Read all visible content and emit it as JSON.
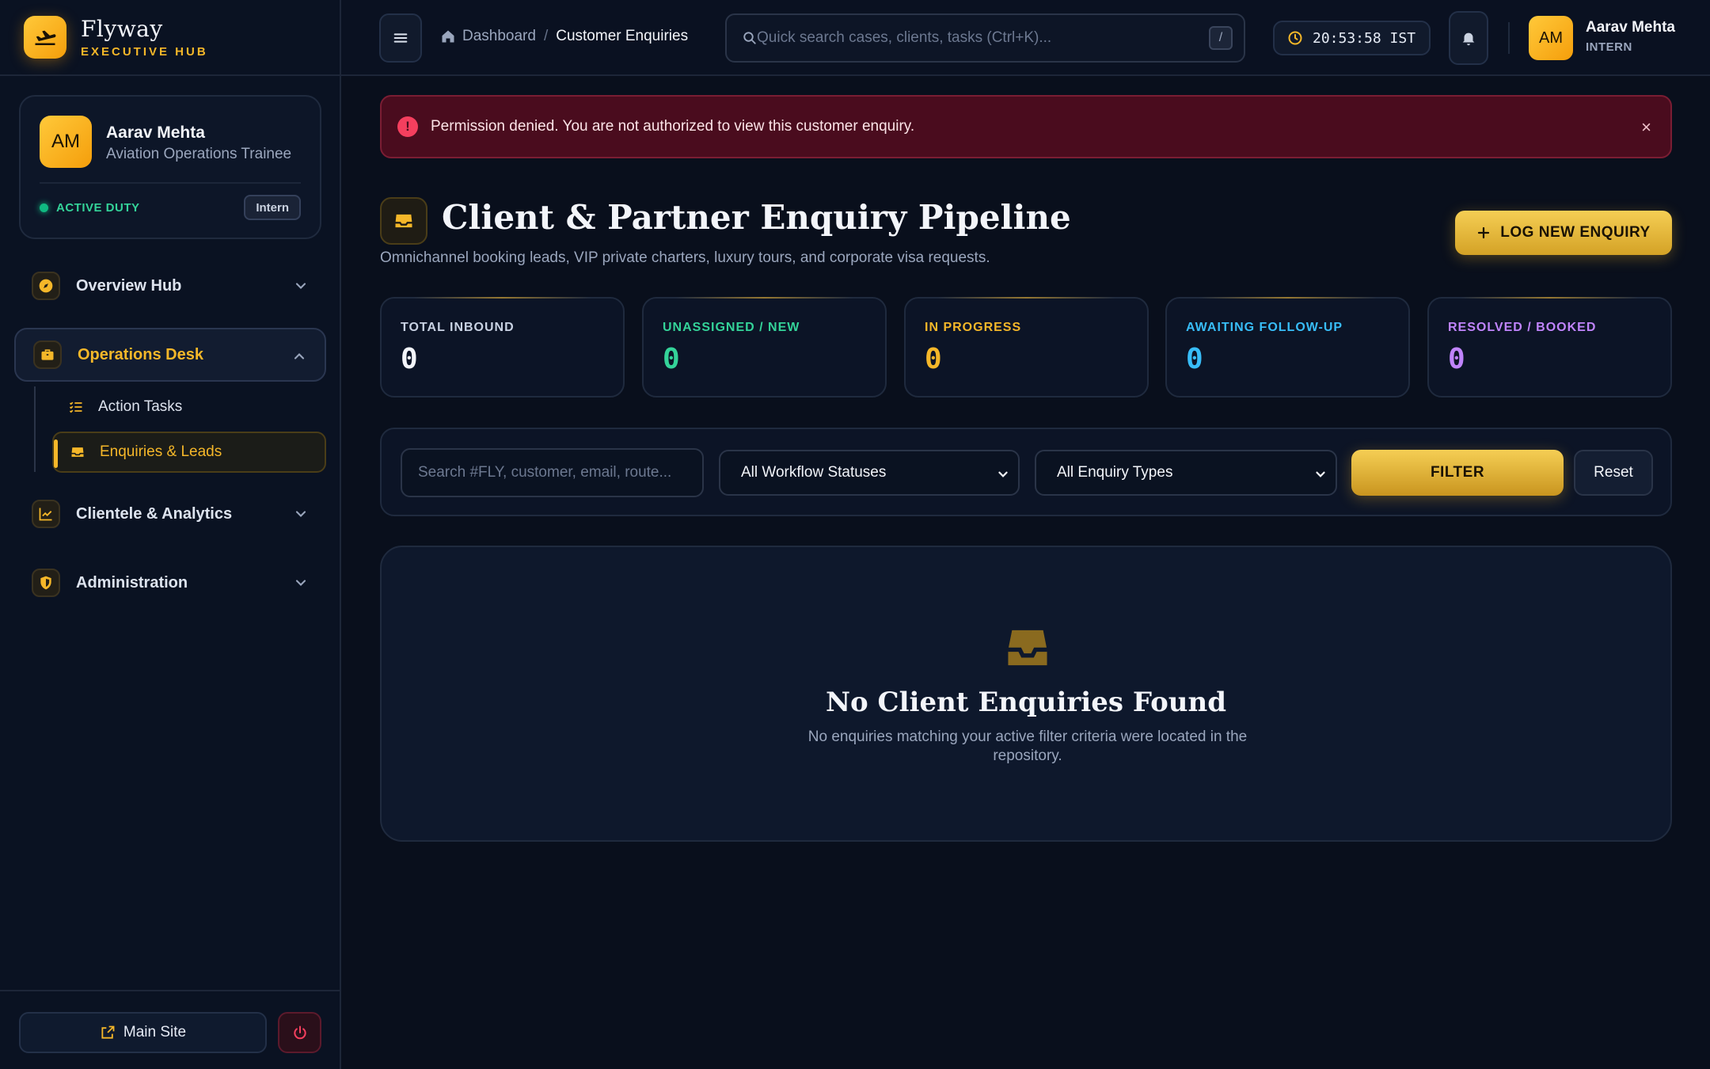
{
  "brand": {
    "name": "Flyway",
    "subtitle": "EXECUTIVE HUB"
  },
  "profile": {
    "initials": "AM",
    "name": "Aarav Mehta",
    "role": "Aviation Operations Trainee",
    "status": "ACTIVE DUTY",
    "badge": "Intern"
  },
  "sidebar": {
    "items": [
      {
        "label": "Overview Hub",
        "icon": "compass-icon"
      },
      {
        "label": "Operations Desk",
        "icon": "briefcase-icon"
      },
      {
        "label": "Clientele & Analytics",
        "icon": "chart-icon"
      },
      {
        "label": "Administration",
        "icon": "shield-icon"
      }
    ],
    "subitems": [
      {
        "label": "Action Tasks",
        "icon": "list-checks-icon"
      },
      {
        "label": "Enquiries & Leads",
        "icon": "inbox-icon"
      }
    ],
    "main_site": "Main Site"
  },
  "topbar": {
    "breadcrumb_home": "Dashboard",
    "breadcrumb_sep": "/",
    "breadcrumb_current": "Customer Enquiries",
    "search_placeholder": "Quick search cases, clients, tasks (Ctrl+K)...",
    "search_shortcut": "/",
    "clock": "20:53:58 IST",
    "user_initials": "AM",
    "user_name": "Aarav Mehta",
    "user_role": "INTERN"
  },
  "alert": {
    "icon": "!",
    "message": "Permission denied. You are not authorized to view this customer enquiry.",
    "close": "×"
  },
  "page": {
    "title": "Client & Partner Enquiry Pipeline",
    "subtitle": "Omnichannel booking leads, VIP private charters, luxury tours, and corporate visa requests.",
    "log_button": "LOG NEW ENQUIRY"
  },
  "stats": [
    {
      "label": "TOTAL INBOUND",
      "value": "0",
      "color": "#c9d2e3"
    },
    {
      "label": "UNASSIGNED / NEW",
      "value": "0",
      "color": "#34d399"
    },
    {
      "label": "IN PROGRESS",
      "value": "0",
      "color": "#f5b729"
    },
    {
      "label": "AWAITING FOLLOW-UP",
      "value": "0",
      "color": "#38bdf8"
    },
    {
      "label": "RESOLVED / BOOKED",
      "value": "0",
      "color": "#c084fc"
    }
  ],
  "filters": {
    "search_placeholder": "Search #FLY, customer, email, route...",
    "status_select": "All Workflow Statuses",
    "type_select": "All Enquiry Types",
    "filter_button": "FILTER",
    "reset_button": "Reset"
  },
  "empty": {
    "title": "No Client Enquiries Found",
    "description": "No enquiries matching your active filter criteria were located in the repository."
  },
  "colors": {
    "accent": "#f5b729",
    "danger": "#f43f5e",
    "success": "#10b981"
  }
}
